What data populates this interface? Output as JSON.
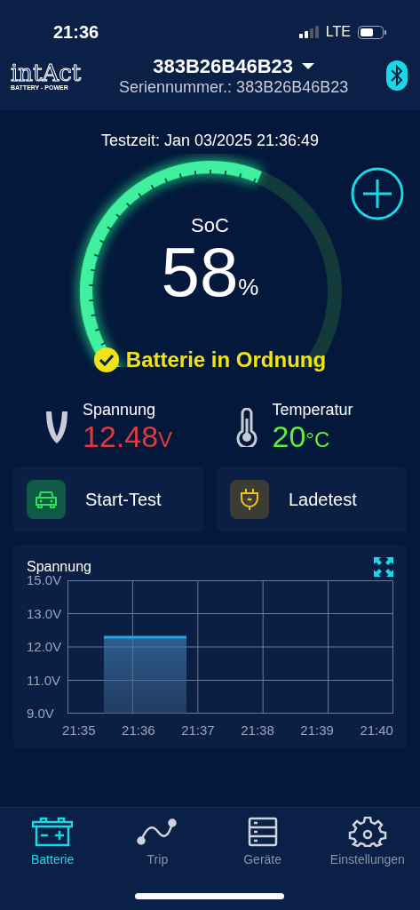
{
  "status_bar": {
    "time": "21:36",
    "network": "LTE"
  },
  "header": {
    "device": "383B26B46B23",
    "serial": "Seriennummer.: 383B26B46B23",
    "logo": "intAct",
    "logo_tagline": "BATTERY - POWER"
  },
  "test_time": "Testzeit: Jan 03/2025 21:36:49",
  "gauge": {
    "label": "SoC",
    "value": "58",
    "unit": "%",
    "status": "Batterie in Ordnung"
  },
  "readings": [
    {
      "kind": "voltage",
      "label": "Spannung",
      "value": "12.48",
      "unit": "V",
      "color": "#e03a3e"
    },
    {
      "kind": "temperature",
      "label": "Temperatur",
      "value": "20",
      "unit": "°C",
      "color": "#5ef03c"
    }
  ],
  "actions": [
    {
      "kind": "car",
      "label": "Start-Test"
    },
    {
      "kind": "plug",
      "label": "Ladetest"
    }
  ],
  "chart": {
    "title": "Spannung",
    "y_labels": [
      "15.0V",
      "13.0V",
      "12.0V",
      "11.0V",
      "9.0V"
    ],
    "x_labels": [
      "21:35",
      "21:36",
      "21:37",
      "21:38",
      "21:39",
      "21:40"
    ]
  },
  "tabs": [
    {
      "kind": "battery",
      "label": "Batterie",
      "selected": true
    },
    {
      "kind": "trip",
      "label": "Trip",
      "selected": false
    },
    {
      "kind": "devices",
      "label": "Geräte",
      "selected": false
    },
    {
      "kind": "settings",
      "label": "Einstellungen",
      "selected": false
    }
  ]
}
